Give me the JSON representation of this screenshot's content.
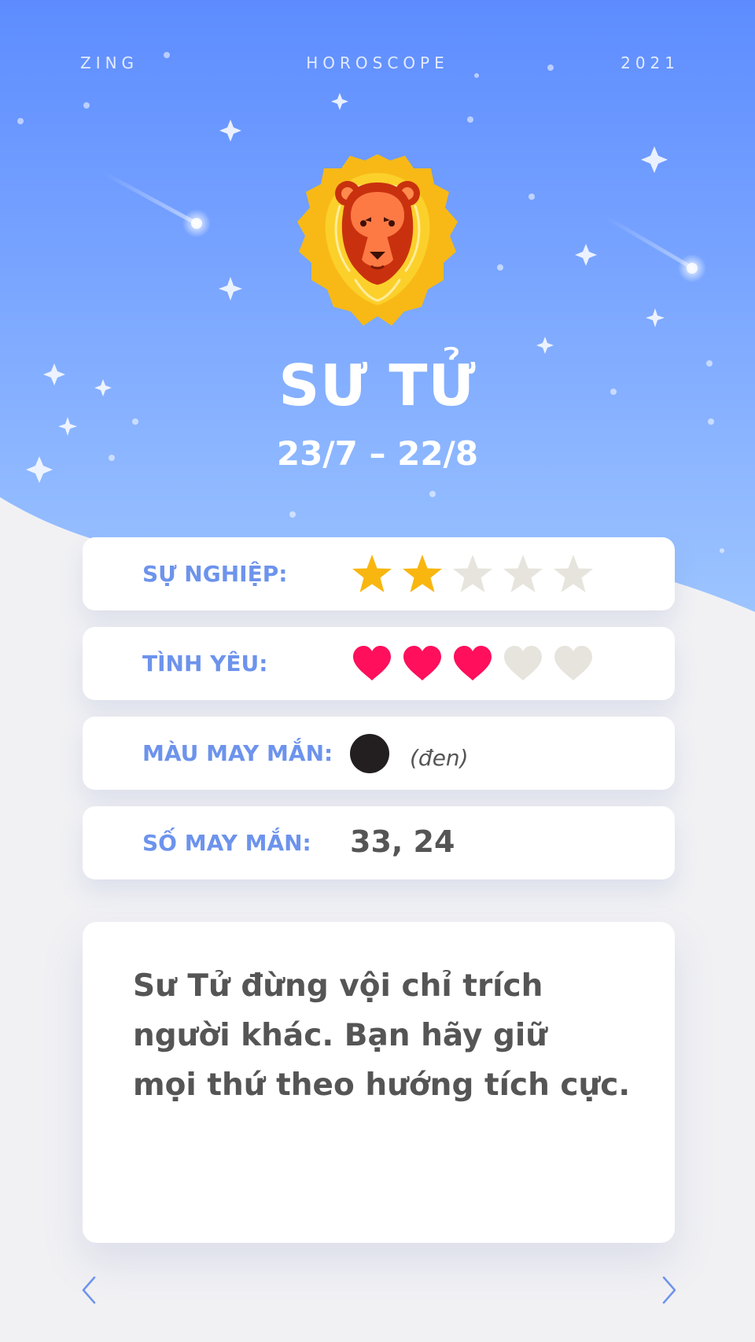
{
  "header": {
    "left": "ZING",
    "center": "HOROSCOPE",
    "right": "2021"
  },
  "sign": {
    "name": "SƯ TỬ",
    "dates": "23/7 – 22/8",
    "icon": "lion-icon"
  },
  "ratings": [
    {
      "label": "SỰ NGHIỆP:",
      "icon": "star-icon",
      "score": 2,
      "max": 5,
      "on_color": "#f8b60f",
      "off_color": "#e6e4dd"
    },
    {
      "label": "TÌNH YÊU:",
      "icon": "heart-icon",
      "score": 3,
      "max": 5,
      "on_color": "#ff0f5c",
      "off_color": "#e6e4dd"
    }
  ],
  "lucky_color": {
    "label": "MÀU MAY MẮN:",
    "name": "(đen)",
    "swatch": "#231f20"
  },
  "lucky_numbers": {
    "label": "SỐ MAY MẮN:",
    "value": "33, 24"
  },
  "message": {
    "lines": [
      "Sư Tử đừng vội chỉ trích",
      "người khác. Bạn hãy giữ",
      "mọi thứ theo hướng tích cực."
    ]
  },
  "nav": {
    "prev_icon": "chevron-left-icon",
    "next_icon": "chevron-right-icon"
  },
  "colors": {
    "sky_top": "#5d8cff",
    "sky_bottom": "#9cc4ff",
    "label_blue": "#6d93ec",
    "background": "#f1f1f4"
  }
}
